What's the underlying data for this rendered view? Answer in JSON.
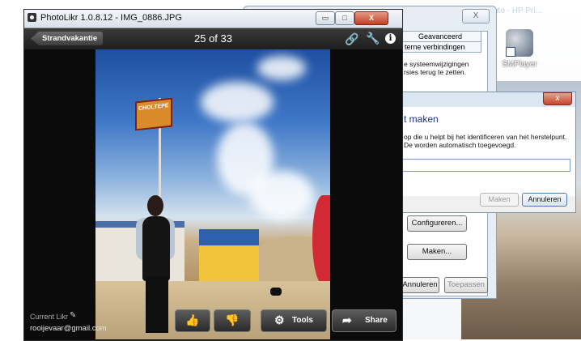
{
  "desktop": {
    "top_text": "uto - HP Pri...",
    "icon_label": "SMPlayer"
  },
  "system_window": {
    "close": "X",
    "tabs": [
      "Geavanceerd",
      "terne verbindingen"
    ],
    "text": "e systeemwijzigingen rsies terug te zetten.",
    "buttons": {
      "configure": "Configureren...",
      "create": "Maken...",
      "cancel": "Annuleren",
      "apply": "Toepassen"
    }
  },
  "restore_dialog": {
    "title": "t maken",
    "text": "op die u helpt bij het identificeren van het herstelpunt. De worden automatisch toegevoegd.",
    "input_value": "",
    "close": "x",
    "create_button": "Maken",
    "cancel_button": "Annuleren"
  },
  "photolikr": {
    "title": "PhotoLikr 1.0.8.12 - IMG_0886.JPG",
    "window_controls": {
      "minimize": "▭",
      "maximize": "□",
      "close": "X"
    },
    "back_label": "Strandvakantie",
    "counter": "25 of 33",
    "current_user_label": "Current Likr",
    "email": "rooijevaar@gmail.com",
    "flag_text": "CHOLTEPE",
    "buttons": {
      "tools": "Tools",
      "share": "Share"
    }
  },
  "icons": [
    "link-icon",
    "wrench-icon",
    "info-icon",
    "thumbs-up-icon",
    "thumbs-down-icon",
    "gear-icon",
    "share-icon",
    "pencil-icon"
  ],
  "colors": {
    "accent_red": "#c33f25",
    "title_blue": "#1e3287",
    "dark_bg": "#111111"
  }
}
